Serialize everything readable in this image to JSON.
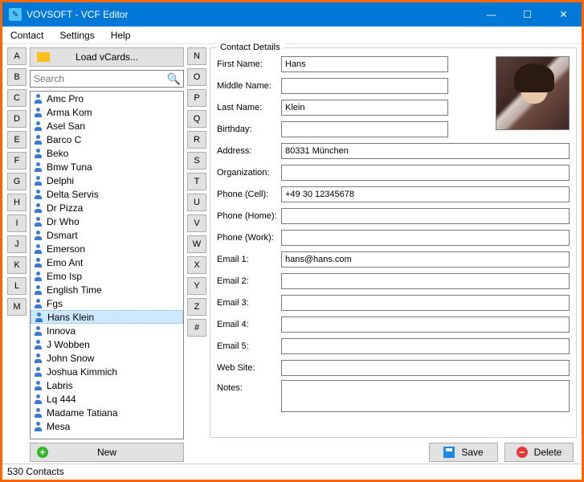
{
  "window": {
    "title": "VOVSOFT - VCF Editor"
  },
  "menu": {
    "contact": "Contact",
    "settings": "Settings",
    "help": "Help"
  },
  "left_letters": [
    "A",
    "B",
    "C",
    "D",
    "E",
    "F",
    "G",
    "H",
    "I",
    "J",
    "K",
    "L",
    "M"
  ],
  "right_letters": [
    "N",
    "O",
    "P",
    "Q",
    "R",
    "S",
    "T",
    "U",
    "V",
    "W",
    "X",
    "Y",
    "Z",
    "#"
  ],
  "buttons": {
    "load": "Load vCards...",
    "new": "New",
    "save": "Save",
    "delete": "Delete"
  },
  "search": {
    "placeholder": "Search"
  },
  "contacts": [
    "Amc Pro",
    "Arma Kom",
    "Asel San",
    "Barco C",
    "Beko",
    "Bmw Tuna",
    "Delphi",
    "Delta Servis",
    "Dr Pizza",
    "Dr Who",
    "Dsmart",
    "Emerson",
    "Emo Ant",
    "Emo Isp",
    "English Time",
    "Fgs",
    "Hans Klein",
    "Innova",
    "J Wobben",
    "John Snow",
    "Joshua Kimmich",
    "Labris",
    "Lq 444",
    "Madame Tatiana",
    "Mesa"
  ],
  "selected_index": 16,
  "details": {
    "legend": "Contact Details",
    "labels": {
      "first_name": "First Name:",
      "middle_name": "Middle Name:",
      "last_name": "Last Name:",
      "birthday": "Birthday:",
      "address": "Address:",
      "organization": "Organization:",
      "phone_cell": "Phone (Cell):",
      "phone_home": "Phone (Home):",
      "phone_work": "Phone (Work):",
      "email1": "Email 1:",
      "email2": "Email 2:",
      "email3": "Email 3:",
      "email4": "Email 4:",
      "email5": "Email 5:",
      "website": "Web Site:",
      "notes": "Notes:"
    },
    "values": {
      "first_name": "Hans",
      "middle_name": "",
      "last_name": "Klein",
      "birthday": "",
      "address": "80331 München",
      "organization": "",
      "phone_cell": "+49 30 12345678",
      "phone_home": "",
      "phone_work": "",
      "email1": "hans@hans.com",
      "email2": "",
      "email3": "",
      "email4": "",
      "email5": "",
      "website": "",
      "notes": ""
    }
  },
  "status": "530 Contacts"
}
